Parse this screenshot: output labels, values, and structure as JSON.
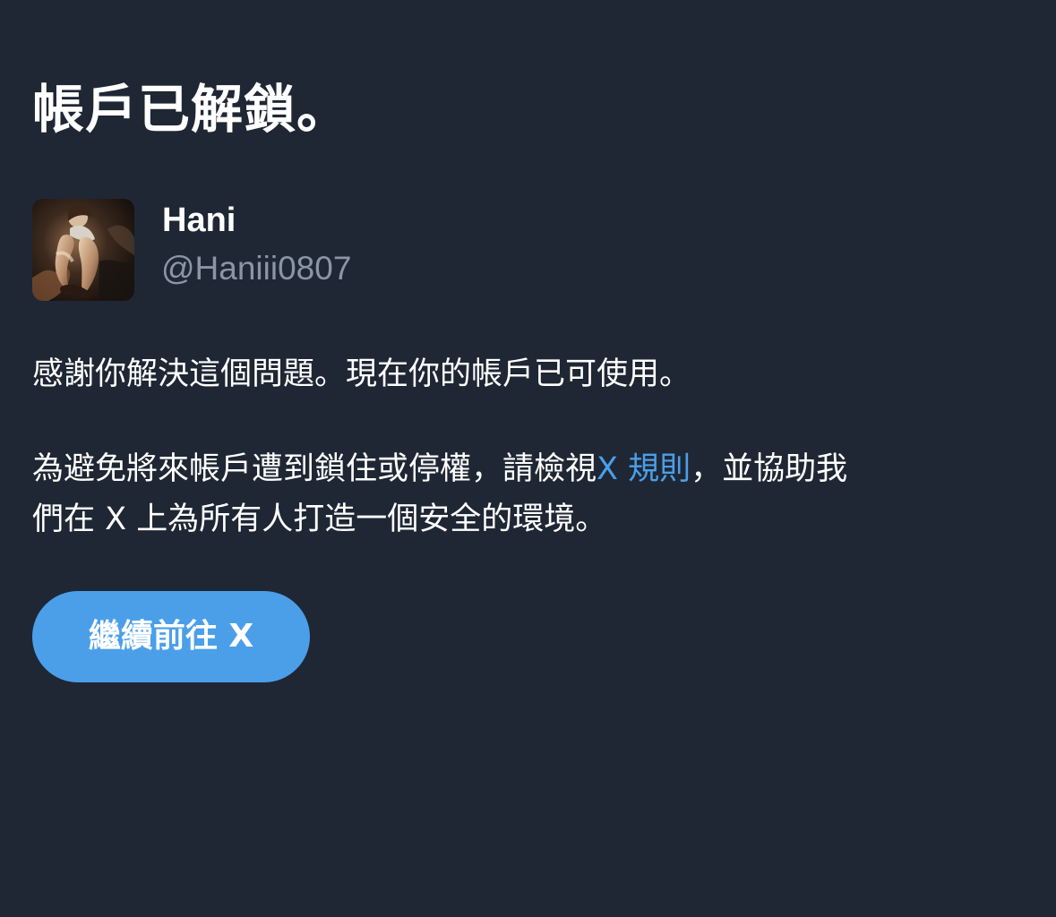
{
  "header": {
    "title": "帳戶已解鎖。"
  },
  "account": {
    "display_name": "Hani",
    "handle": "@Haniii0807",
    "avatar_icon": "profile-photo"
  },
  "body": {
    "message": "感謝你解決這個問題。現在你的帳戶已可使用。",
    "policy_prefix": "為避免將來帳戶遭到鎖住或停權，請檢視",
    "rules_link": "X 規則",
    "policy_suffix_line_1": "，並協助我",
    "policy_line_2": "們在 X 上為所有人打造一個安全的環境。"
  },
  "actions": {
    "continue_label": "繼續前往 X"
  },
  "colors": {
    "background": "#1f2734",
    "text": "#ffffff",
    "secondary_text": "#8a96a5",
    "accent": "#4b9fe9"
  }
}
